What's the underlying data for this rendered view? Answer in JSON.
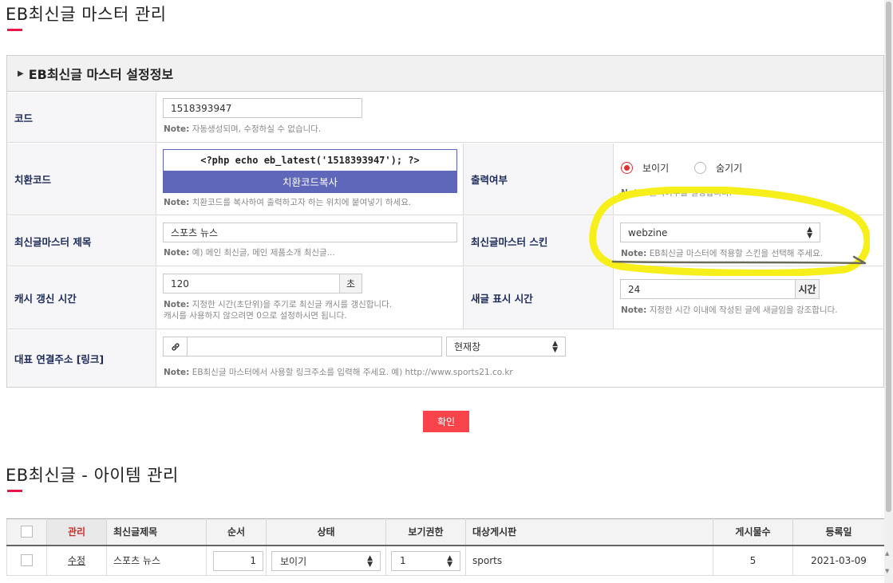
{
  "page": {
    "title": "EB최신글 마스터 관리",
    "section_title": "EB최신글 마스터 설정정보",
    "items_title": "EB최신글 - 아이템 관리"
  },
  "form": {
    "code": {
      "label": "코드",
      "value": "1518393947",
      "note_prefix": "Note:",
      "note": "자동생성되며, 수정하실 수 없습니다."
    },
    "replace_code": {
      "label": "치환코드",
      "code_text": "<?php echo eb_latest('1518393947'); ?>",
      "copy_button": "치환코드복사",
      "note_prefix": "Note:",
      "note": "치환코드를 복사하여 출력하고자 하는 위치에 붙여넣기 하세요."
    },
    "output": {
      "label": "출력여부",
      "options": [
        "보이기",
        "숨기기"
      ],
      "selected": "보이기",
      "note_prefix": "Note:",
      "note": "출력여부를 결정합니다."
    },
    "master_title": {
      "label": "최신글마스터 제목",
      "value": "스포츠 뉴스",
      "note_prefix": "Note:",
      "note": "예) 메인 최신글, 메인 제품소개 최신글..."
    },
    "master_skin": {
      "label": "최신글마스터 스킨",
      "value": "webzine",
      "note_prefix": "Note:",
      "note": "EB최신글 마스터에 적용할 스킨을 선택해 주세요."
    },
    "cache": {
      "label": "캐시 갱신 시간",
      "value": "120",
      "unit": "초",
      "note_prefix": "Note:",
      "note_line1": "지정한 시간(초단위)을 주기로 최신글 캐시를 갱신합니다.",
      "note_line2": "캐시를 사용하지 않으려면 0으로 설정하시면 됩니다."
    },
    "new_post": {
      "label": "새글 표시 시간",
      "value": "24",
      "unit": "시간",
      "note_prefix": "Note:",
      "note": "지정한 시간 이내에 작성된 글에 새글임을 강조합니다."
    },
    "link": {
      "label": "대표 연결주소 [링크]",
      "value": "",
      "target": "현재창",
      "note_prefix": "Note:",
      "note": "EB최신글 마스터에서 사용할 링크주소를 입력해 주세요. 예) http://www.sports21.co.kr"
    }
  },
  "confirm_button": "확인",
  "items_table": {
    "columns": [
      "관리",
      "최신글제목",
      "순서",
      "상태",
      "보기권한",
      "대상게시판",
      "게시물수",
      "등록일"
    ],
    "rows": [
      {
        "manage": "수정",
        "title": "스포츠 뉴스",
        "order": "1",
        "status": "보이기",
        "permission": "1",
        "board": "sports",
        "count": "5",
        "date": "2021-03-09"
      }
    ]
  },
  "colors": {
    "accent": "#e8174a",
    "copy_button": "#5f67ba",
    "confirm_button": "#f8434b",
    "label_text": "#1b2a57",
    "highlight": "#f6ef1a"
  }
}
